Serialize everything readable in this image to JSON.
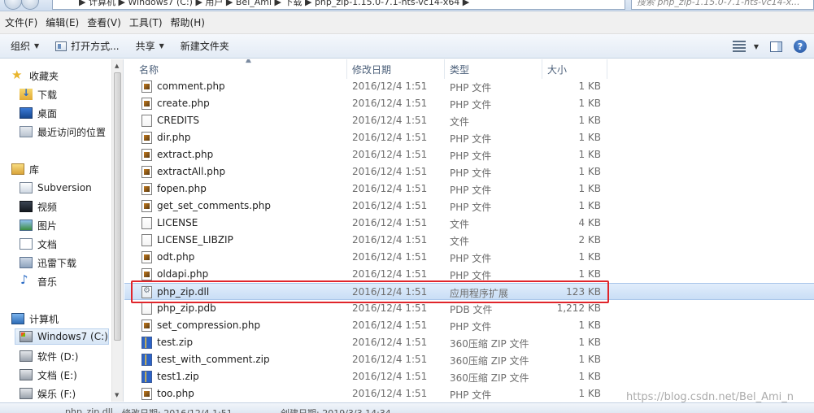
{
  "window": {
    "address_path": "▶ 计算机 ▶ Windows7 (C:) ▶ 用户 ▶ Bel_Ami ▶ 下载 ▶ php_zip-1.15.0-7.1-nts-vc14-x64 ▶",
    "search_placeholder": "搜索 php_zip-1.15.0-7.1-nts-vc14-x..."
  },
  "menubar": {
    "items": [
      "文件(F)",
      "编辑(E)",
      "查看(V)",
      "工具(T)",
      "帮助(H)"
    ]
  },
  "toolbar": {
    "organize_label": "组织",
    "open_with_label": "打开方式...",
    "share_label": "共享",
    "new_folder_label": "新建文件夹"
  },
  "nav": {
    "favorites_label": "收藏夹",
    "downloads_label": "下载",
    "desktop_label": "桌面",
    "recent_label": "最近访问的位置",
    "libraries_label": "库",
    "svn_label": "Subversion",
    "video_label": "视频",
    "pictures_label": "图片",
    "documents_label": "文档",
    "thunder_label": "迅雷下载",
    "music_label": "音乐",
    "computer_label": "计算机",
    "drive_c_label": "Windows7 (C:)",
    "drive_d_label": "软件 (D:)",
    "drive_e_label": "文档 (E:)",
    "drive_f_label": "娱乐 (F:)"
  },
  "columns": {
    "name": "名称",
    "date": "修改日期",
    "type": "类型",
    "size": "大小"
  },
  "files": [
    {
      "name": "comment.php",
      "date": "2016/12/4 1:51",
      "type": "PHP 文件",
      "size": "1 KB",
      "icon": "php-file-icon"
    },
    {
      "name": "create.php",
      "date": "2016/12/4 1:51",
      "type": "PHP 文件",
      "size": "1 KB",
      "icon": "php-file-icon"
    },
    {
      "name": "CREDITS",
      "date": "2016/12/4 1:51",
      "type": "文件",
      "size": "1 KB",
      "icon": "blank-file-icon"
    },
    {
      "name": "dir.php",
      "date": "2016/12/4 1:51",
      "type": "PHP 文件",
      "size": "1 KB",
      "icon": "php-file-icon"
    },
    {
      "name": "extract.php",
      "date": "2016/12/4 1:51",
      "type": "PHP 文件",
      "size": "1 KB",
      "icon": "php-file-icon"
    },
    {
      "name": "extractAll.php",
      "date": "2016/12/4 1:51",
      "type": "PHP 文件",
      "size": "1 KB",
      "icon": "php-file-icon"
    },
    {
      "name": "fopen.php",
      "date": "2016/12/4 1:51",
      "type": "PHP 文件",
      "size": "1 KB",
      "icon": "php-file-icon"
    },
    {
      "name": "get_set_comments.php",
      "date": "2016/12/4 1:51",
      "type": "PHP 文件",
      "size": "1 KB",
      "icon": "php-file-icon"
    },
    {
      "name": "LICENSE",
      "date": "2016/12/4 1:51",
      "type": "文件",
      "size": "4 KB",
      "icon": "blank-file-icon"
    },
    {
      "name": "LICENSE_LIBZIP",
      "date": "2016/12/4 1:51",
      "type": "文件",
      "size": "2 KB",
      "icon": "blank-file-icon"
    },
    {
      "name": "odt.php",
      "date": "2016/12/4 1:51",
      "type": "PHP 文件",
      "size": "1 KB",
      "icon": "php-file-icon"
    },
    {
      "name": "oldapi.php",
      "date": "2016/12/4 1:51",
      "type": "PHP 文件",
      "size": "1 KB",
      "icon": "php-file-icon"
    },
    {
      "name": "php_zip.dll",
      "date": "2016/12/4 1:51",
      "type": "应用程序扩展",
      "size": "123 KB",
      "icon": "dll-file-icon"
    },
    {
      "name": "php_zip.pdb",
      "date": "2016/12/4 1:51",
      "type": "PDB 文件",
      "size": "1,212 KB",
      "icon": "blank-file-icon"
    },
    {
      "name": "set_compression.php",
      "date": "2016/12/4 1:51",
      "type": "PHP 文件",
      "size": "1 KB",
      "icon": "php-file-icon"
    },
    {
      "name": "test.zip",
      "date": "2016/12/4 1:51",
      "type": "360压缩 ZIP 文件",
      "size": "1 KB",
      "icon": "zip-file-icon"
    },
    {
      "name": "test_with_comment.zip",
      "date": "2016/12/4 1:51",
      "type": "360压缩 ZIP 文件",
      "size": "1 KB",
      "icon": "zip-file-icon"
    },
    {
      "name": "test1.zip",
      "date": "2016/12/4 1:51",
      "type": "360压缩 ZIP 文件",
      "size": "1 KB",
      "icon": "zip-file-icon"
    },
    {
      "name": "too.php",
      "date": "2016/12/4 1:51",
      "type": "PHP 文件",
      "size": "1 KB",
      "icon": "php-file-icon"
    }
  ],
  "details": {
    "filename": "php_zip.dll",
    "modified_label": "修改日期: 2016/12/4 1:51",
    "created_label": "创建日期: 2019/3/3 14:34"
  },
  "watermark": "https://blog.csdn.net/Bel_Ami_n",
  "colors": {
    "highlight_border": "#e0252b",
    "selection": "#c9def6"
  }
}
